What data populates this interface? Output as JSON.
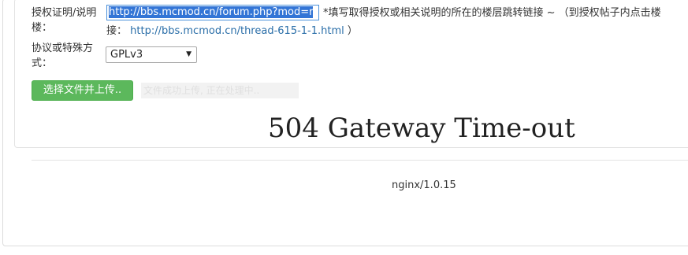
{
  "form": {
    "license_label_line1": "授权证明/说明",
    "license_label_line2": "楼：",
    "license_url_value": "http://bbs.mcmod.cn/forum.php?mod=r",
    "hint_line1": "*填写取得授权或相关说明的所在的楼层跳转链接 ~ （到授权帖子内点击楼",
    "hint_line2_prefix": "接：",
    "hint_line2_link": "http://bbs.mcmod.cn/thread-615-1-1.html",
    "hint_line2_suffix": "）",
    "protocol_label_line1": "协议或特殊方",
    "protocol_label_line2": "式：",
    "protocol_selected": "GPLv3",
    "upload_button_label": "选择文件并上传..",
    "upload_status_text": "文件成功上传, 正在处理中.."
  },
  "error_page": {
    "title": "504 Gateway Time-out",
    "server": "nginx/1.0.15"
  }
}
